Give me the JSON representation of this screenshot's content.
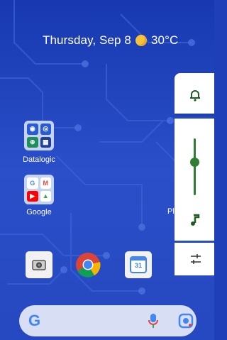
{
  "glance": {
    "date": "Thursday, Sep 8",
    "temperature": "30°C",
    "weather_icon": "sun-icon"
  },
  "folders": [
    {
      "label": "Datalogic",
      "apps": [
        "datalogic-app-1-icon",
        "datalogic-app-2-icon",
        "datalogic-app-3-icon",
        "datalogic-app-4-icon"
      ]
    },
    {
      "label": "Google",
      "apps": [
        "google-icon",
        "gmail-icon",
        "youtube-icon",
        "drive-icon"
      ]
    }
  ],
  "partial_label": "Pl",
  "dock": [
    "camera-icon",
    "chrome-icon",
    "calendar-icon"
  ],
  "calendar_day": "31",
  "search": {
    "logo": "G",
    "mic_icon": "mic-icon",
    "lens_icon": "lens-icon"
  },
  "volume_panel": {
    "ring_icon": "bell-icon",
    "media_icon": "music-note-icon",
    "settings_icon": "sliders-icon",
    "level": 0.55
  }
}
